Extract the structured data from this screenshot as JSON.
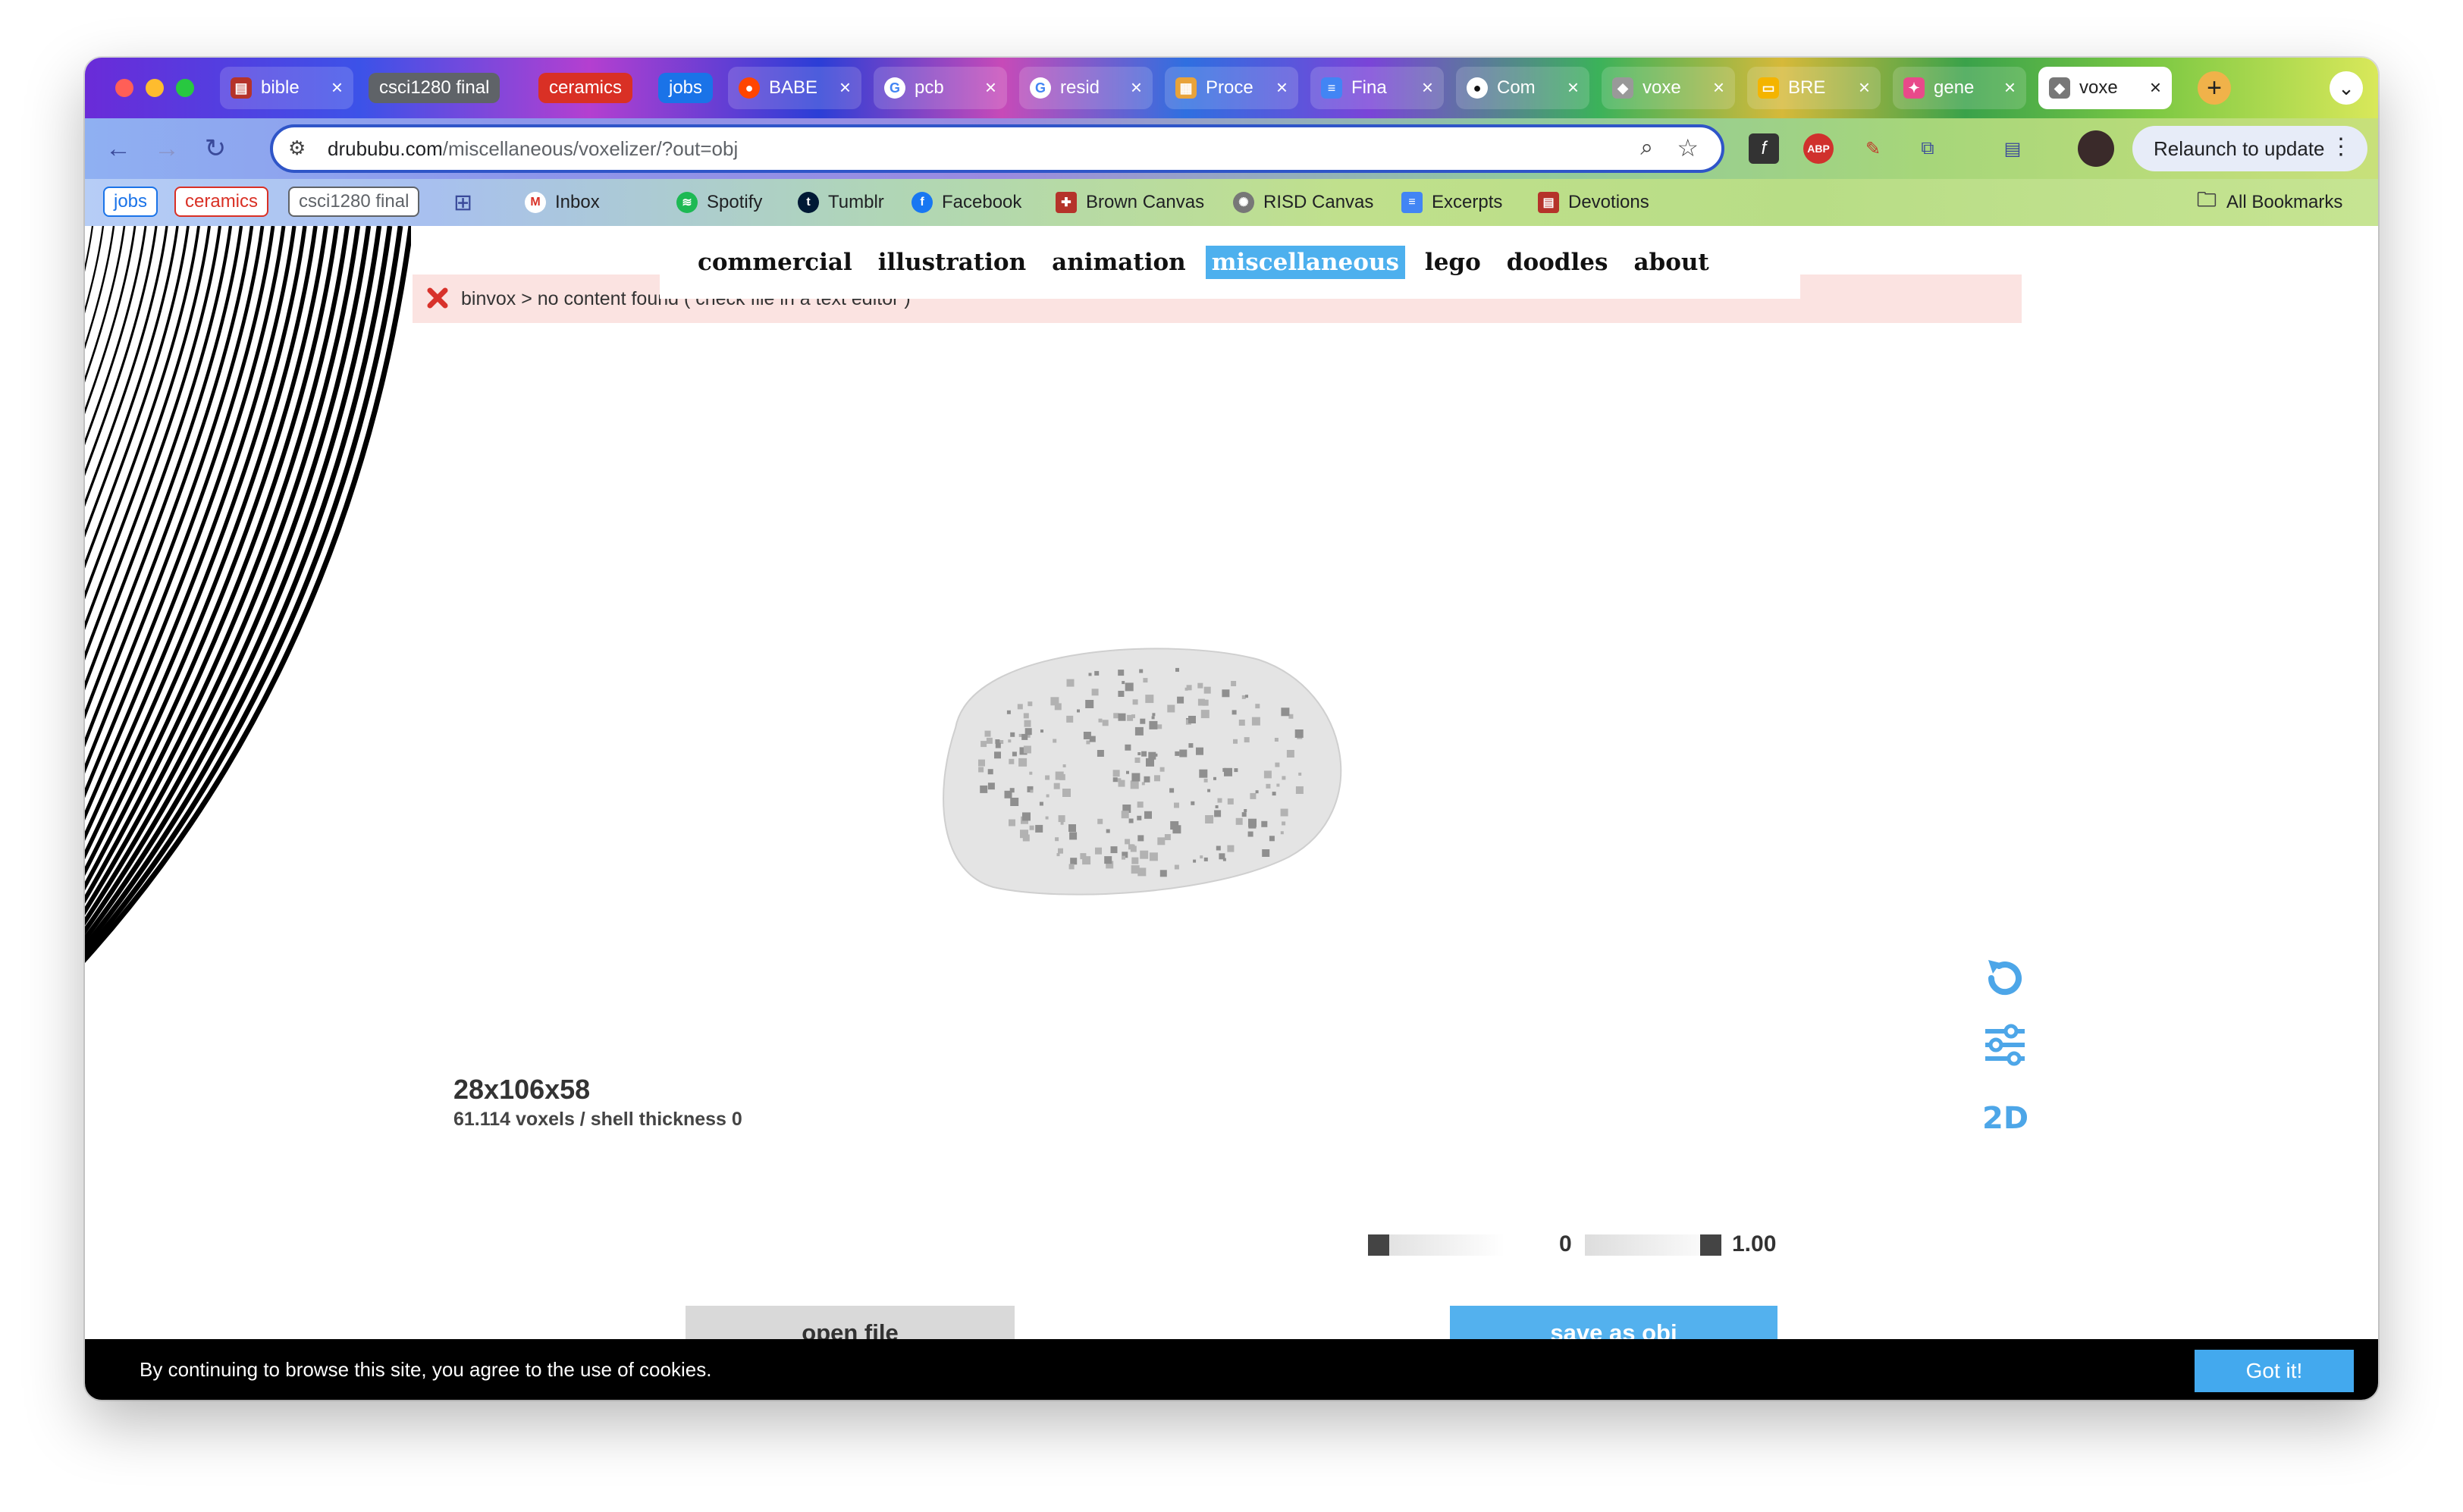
{
  "browser": {
    "tabs": [
      {
        "label": "bible",
        "favicon": "book-icon"
      },
      {
        "label": "BABE",
        "favicon": "reddit-icon"
      },
      {
        "label": "pcb",
        "favicon": "google-icon"
      },
      {
        "label": "resid",
        "favicon": "google-icon"
      },
      {
        "label": "Proce",
        "favicon": "doc-icon"
      },
      {
        "label": "Fina",
        "favicon": "docs-icon"
      },
      {
        "label": "Com",
        "favicon": "github-icon"
      },
      {
        "label": "voxe",
        "favicon": "voxel-icon"
      },
      {
        "label": "BRE",
        "favicon": "slides-icon"
      },
      {
        "label": "gene",
        "favicon": "palette-icon"
      },
      {
        "label": "voxe",
        "favicon": "voxel-icon",
        "active": true
      }
    ],
    "tab_groups": [
      {
        "label": "csci1280 final",
        "color": "#5f6368"
      },
      {
        "label": "ceramics",
        "color": "#d93025"
      },
      {
        "label": "jobs",
        "color": "#1a73e8"
      }
    ],
    "close_glyph": "×",
    "new_tab_glyph": "+",
    "url_host": "drububu.com",
    "url_path": "/miscellaneous/voxelizer/?out=obj",
    "relaunch_label": "Relaunch to update",
    "bookmarks": [
      {
        "label": "jobs"
      },
      {
        "label": "ceramics"
      },
      {
        "label": "csci1280 final"
      },
      {
        "label": "Inbox"
      },
      {
        "label": "Spotify"
      },
      {
        "label": "Tumblr"
      },
      {
        "label": "Facebook"
      },
      {
        "label": "Brown Canvas"
      },
      {
        "label": "RISD Canvas"
      },
      {
        "label": "Excerpts"
      },
      {
        "label": "Devotions"
      },
      {
        "label": "All Bookmarks"
      }
    ]
  },
  "site": {
    "nav": [
      "commercial",
      "illustration",
      "animation",
      "miscellaneous",
      "lego",
      "doodles",
      "about"
    ],
    "active_nav": "miscellaneous",
    "alert_text": "binvox > no content found ( check file in a text editor )",
    "dimensions": "28x106x58",
    "voxel_info": "61.114 voxels / shell thickness 0",
    "slider1_value": "0",
    "slider2_value": "1.00",
    "open_file_label": "open file",
    "save_label": "save as obj",
    "cookie_text": "By continuing to browse this site, you agree to the use of cookies.",
    "cookie_button": "Got it!",
    "accent_color": "#4db0ee",
    "side_icons": [
      "rotate-icon",
      "sliders-icon",
      "2d-icon"
    ],
    "side_icon_2d_text": "2D"
  }
}
